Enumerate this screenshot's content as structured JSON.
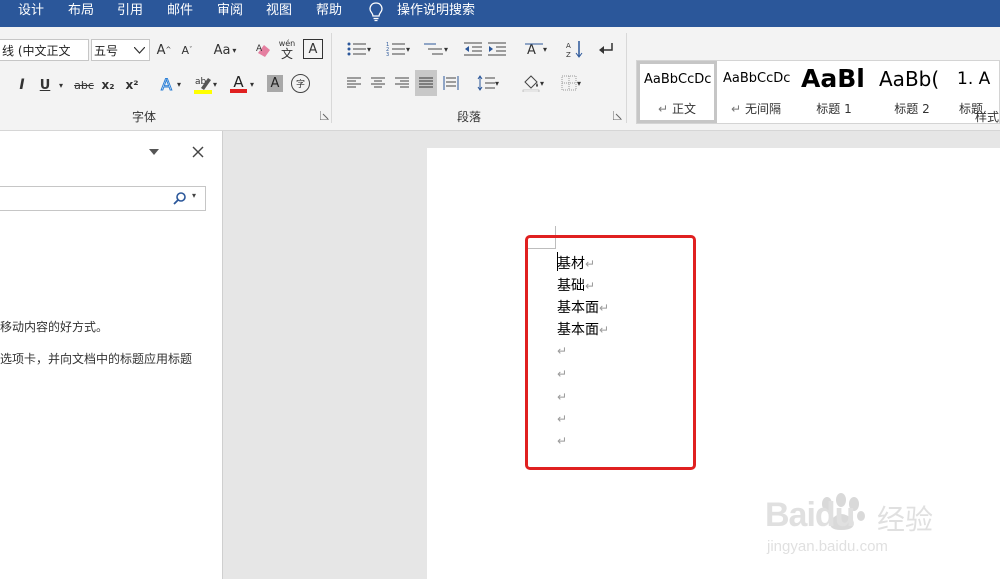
{
  "tabs": [
    "设计",
    "布局",
    "引用",
    "邮件",
    "审阅",
    "视图",
    "帮助"
  ],
  "tell_me": "操作说明搜索",
  "font": {
    "name": "线 (中文正文",
    "size": "五号",
    "group_label": "字体",
    "grow": "A",
    "shrink": "A",
    "change_case": "Aa",
    "italic": "I",
    "underline": "U",
    "strike": "abc",
    "sub": "x₂",
    "sup": "x²",
    "font_color": "A",
    "shade": "A",
    "phonetic": "wén",
    "phonetic_char": "文",
    "border_char": "A",
    "enclose": "字"
  },
  "paragraph": {
    "group_label": "段落"
  },
  "styles": {
    "group_label": "样式",
    "items": [
      {
        "preview": "AaBbCcDc",
        "name": "正文"
      },
      {
        "preview": "AaBbCcDc",
        "name": "无间隔"
      },
      {
        "preview": "AaBl",
        "name": "标题 1"
      },
      {
        "preview": "AaBb(",
        "name": "标题 2"
      },
      {
        "preview": "1.  A",
        "name": "标题"
      }
    ]
  },
  "nav": {
    "text1": "移动内容的好方式。",
    "text2": "选项卡，并向文档中的标题应用标题"
  },
  "document": {
    "lines": [
      "基材",
      "基础",
      "基本面",
      "基本面",
      "",
      "",
      "",
      "",
      ""
    ],
    "para_mark": "↵"
  },
  "watermark": {
    "brand": "Baidu",
    "cn": "经验",
    "url": "jingyan.baidu.com"
  },
  "colors": {
    "accent": "#2b579a",
    "highlight_box": "#e02020",
    "font_red": "#e02020",
    "highlighter_yellow": "#ffff00"
  }
}
